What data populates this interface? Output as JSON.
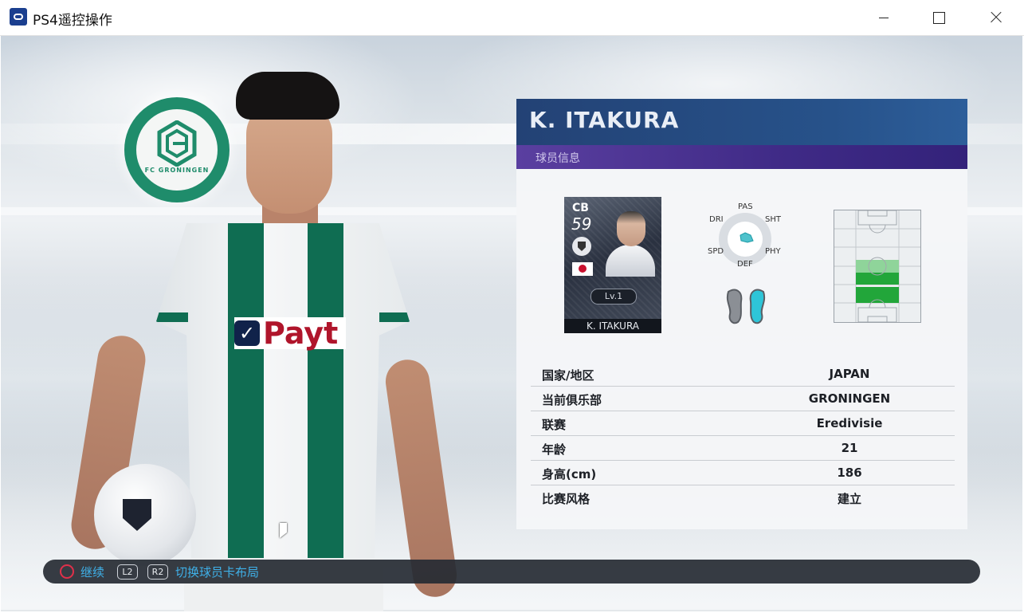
{
  "window": {
    "title": "PS4遥控操作",
    "icons": {
      "app": "ps4-remote-play-icon",
      "minimize": "minimize-icon",
      "maximize": "maximize-icon",
      "close": "close-icon"
    }
  },
  "scene": {
    "crest_text": "FC GRONINGEN",
    "sponsor_text": "Payt",
    "colors": {
      "club_green": "#0f6d52",
      "panel_blue": "#27528a",
      "panel_purple": "#4a3494",
      "hint_blue": "#3fb0e8"
    }
  },
  "panel": {
    "player_name": "K. ITAKURA",
    "section_label": "球员信息",
    "card": {
      "position": "CB",
      "rating": "59",
      "level": "Lv.1",
      "name": "K. ITAKURA",
      "nationality_flag": "japan-flag-icon"
    },
    "radar": {
      "labels": {
        "pas": "PAS",
        "sht": "SHT",
        "phy": "PHY",
        "def": "DEF",
        "spd": "SPD",
        "dri": "DRI"
      }
    },
    "preferred_foot_icon": "feet-icon",
    "position_map": {
      "highlighted_zones": [
        "centre-back",
        "defensive-midfield"
      ],
      "strong_color": "#22a63a",
      "weak_color": "#8fd49a"
    },
    "stats": [
      {
        "label": "国家/地区",
        "value": "JAPAN"
      },
      {
        "label": "当前俱乐部",
        "value": "GRONINGEN"
      },
      {
        "label": "联赛",
        "value": "Eredivisie"
      },
      {
        "label": "年龄",
        "value": "21"
      },
      {
        "label": "身高(cm)",
        "value": "186"
      },
      {
        "label": "比赛风格",
        "value": "建立"
      }
    ]
  },
  "hints": {
    "continue_button_icon": "circle-button-icon",
    "continue_label": "继续",
    "l2_key": "L2",
    "r2_key": "R2",
    "switch_layout_label": "切换球员卡布局"
  }
}
